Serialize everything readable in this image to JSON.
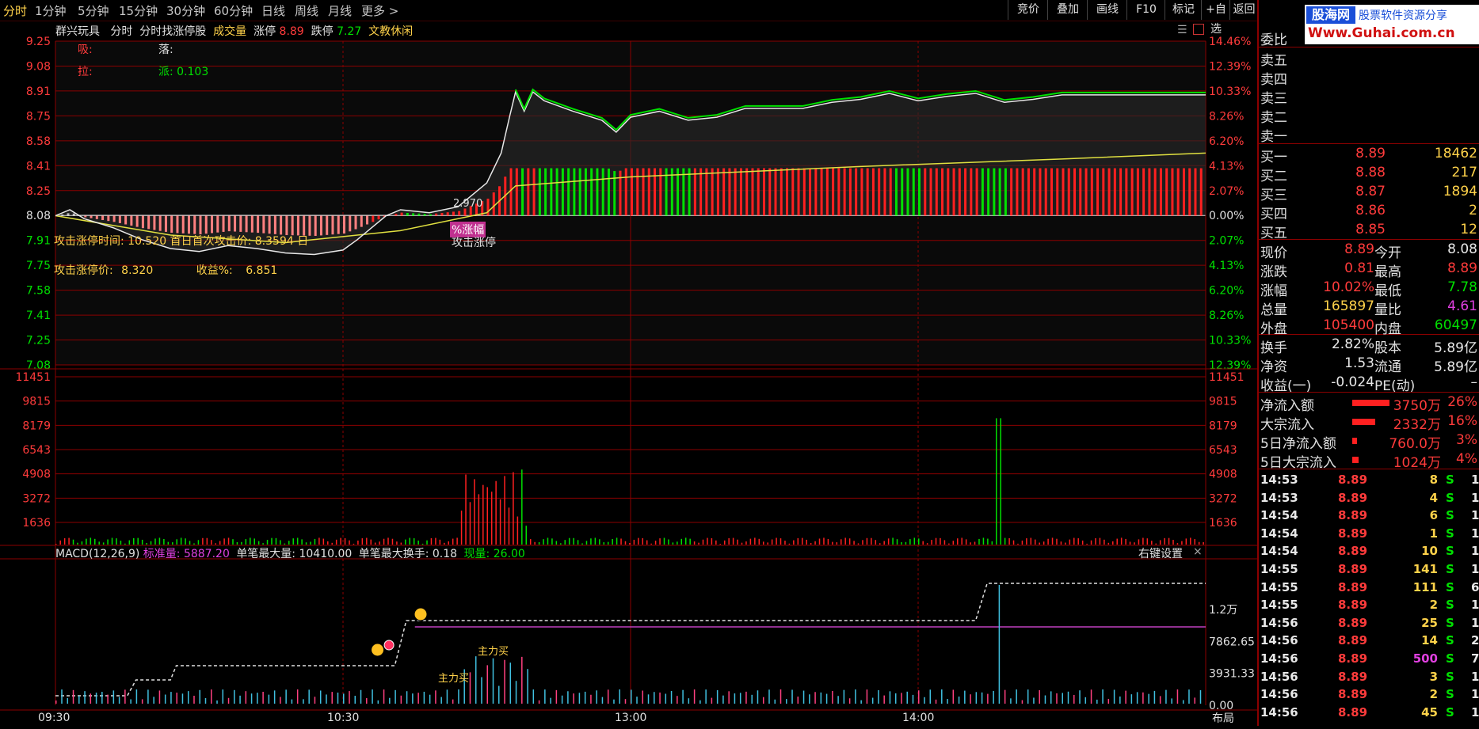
{
  "tabs": [
    {
      "label": "分时",
      "active": true
    },
    {
      "label": "1分钟"
    },
    {
      "label": "5分钟"
    },
    {
      "label": "15分钟"
    },
    {
      "label": "30分钟"
    },
    {
      "label": "60分钟"
    },
    {
      "label": "日线"
    },
    {
      "label": "周线"
    },
    {
      "label": "月线"
    },
    {
      "label": "更多 >"
    }
  ],
  "toolbar": [
    "竞价",
    "叠加",
    "画线",
    "F10",
    "标记",
    "+自选",
    "返回"
  ],
  "header": {
    "stock": "群兴玩具",
    "mode": "分时",
    "indicator": "分时找涨停股",
    "vol_label": "成交量",
    "up_label": "涨停",
    "up_val": "8.89",
    "down_label": "跌停",
    "down_val": "7.27",
    "sector": "文教休闲"
  },
  "indicator_labels": {
    "xi": "吸:",
    "luo": "落:",
    "la": "拉:",
    "pai": "派: 0.103"
  },
  "attack": {
    "line1": "攻击涨停时间: 10.520 首日首次攻击价: 8.3594 日",
    "price_label": "攻击涨停价:",
    "price_val": "8.320",
    "profit_label": "收益%:",
    "profit_val": "6.851",
    "marker_val": "2.970",
    "pct_label": "%涨幅",
    "attack_label": "攻击涨停"
  },
  "price_axis_left": [
    "9.25",
    "9.08",
    "8.91",
    "8.75",
    "8.58",
    "8.41",
    "8.25",
    "8.08",
    "7.91",
    "7.75",
    "7.58",
    "7.41",
    "7.25",
    "7.08"
  ],
  "price_axis_right": [
    "14.46%",
    "12.39%",
    "10.33%",
    "8.26%",
    "6.20%",
    "4.13%",
    "2.07%",
    "0.00%",
    "2.07%",
    "4.13%",
    "6.20%",
    "8.26%",
    "10.33%",
    "12.39%"
  ],
  "vol_axis": [
    "11451",
    "9815",
    "8179",
    "6543",
    "4908",
    "3272",
    "1636"
  ],
  "macd": {
    "label": "MACD(12,26,9)",
    "std_label": "标准量:",
    "std_val": "5887.20",
    "max_vol": "单笔最大量: 10410.00",
    "max_turn": "单笔最大换手: 0.18",
    "cur_label": "现量:",
    "cur_val": "26.00",
    "settings": "右键设置",
    "close": "×",
    "axis": [
      "1.2万",
      "7862.65",
      "3931.33",
      "0.00"
    ],
    "buy_label": "主力买"
  },
  "time_axis": [
    "09:30",
    "10:30",
    "13:00",
    "14:00"
  ],
  "layout_btn": "布局",
  "logo": {
    "name": "股海网",
    "slogan": "股票软件资源分享",
    "url": "Www.Guhai.com.cn"
  },
  "orderbook": {
    "weibi": "委比",
    "sell": [
      "卖五",
      "卖四",
      "卖三",
      "卖二",
      "卖一"
    ],
    "buy": [
      {
        "label": "买一",
        "price": "8.89",
        "vol": "18462"
      },
      {
        "label": "买二",
        "price": "8.88",
        "vol": "217"
      },
      {
        "label": "买三",
        "price": "8.87",
        "vol": "1894"
      },
      {
        "label": "买四",
        "price": "8.86",
        "vol": "2"
      },
      {
        "label": "买五",
        "price": "8.85",
        "vol": "12"
      }
    ]
  },
  "quote": [
    {
      "l1": "现价",
      "v1": "8.89",
      "c1": "red",
      "l2": "今开",
      "v2": "8.08",
      "c2": "wht"
    },
    {
      "l1": "涨跌",
      "v1": "0.81",
      "c1": "red",
      "l2": "最高",
      "v2": "8.89",
      "c2": "red"
    },
    {
      "l1": "涨幅",
      "v1": "10.02%",
      "c1": "red",
      "l2": "最低",
      "v2": "7.78",
      "c2": "grn"
    },
    {
      "l1": "总量",
      "v1": "165897",
      "c1": "yel",
      "l2": "量比",
      "v2": "4.61",
      "c2": "mag"
    },
    {
      "l1": "外盘",
      "v1": "105400",
      "c1": "red",
      "l2": "内盘",
      "v2": "60497",
      "c2": "grn"
    }
  ],
  "fund": [
    {
      "l1": "换手",
      "v1": "2.82%",
      "l2": "股本",
      "v2": "5.89亿"
    },
    {
      "l1": "净资",
      "v1": "1.53",
      "l2": "流通",
      "v2": "5.89亿"
    },
    {
      "l1": "收益(一)",
      "v1": "-0.024",
      "l2": "PE(动)",
      "v2": "–"
    }
  ],
  "flow": [
    {
      "label": "净流入额",
      "val": "3750万",
      "pct": "26%",
      "bar": 0.9
    },
    {
      "label": "大宗流入",
      "val": "2332万",
      "pct": "16%",
      "bar": 0.55
    },
    {
      "label": "5日净流入额",
      "val": "760.0万",
      "pct": "3%",
      "bar": 0.12
    },
    {
      "label": "5日大宗流入",
      "val": "1024万",
      "pct": "4%",
      "bar": 0.15
    }
  ],
  "ticks": [
    {
      "t": "14:53",
      "p": "8.89",
      "v": "8",
      "s": "S",
      "n": "1"
    },
    {
      "t": "14:53",
      "p": "8.89",
      "v": "4",
      "s": "S",
      "n": "1"
    },
    {
      "t": "14:54",
      "p": "8.89",
      "v": "6",
      "s": "S",
      "n": "1"
    },
    {
      "t": "14:54",
      "p": "8.89",
      "v": "1",
      "s": "S",
      "n": "1"
    },
    {
      "t": "14:54",
      "p": "8.89",
      "v": "10",
      "s": "S",
      "n": "1"
    },
    {
      "t": "14:55",
      "p": "8.89",
      "v": "141",
      "s": "S",
      "n": "1"
    },
    {
      "t": "14:55",
      "p": "8.89",
      "v": "111",
      "s": "S",
      "n": "6"
    },
    {
      "t": "14:55",
      "p": "8.89",
      "v": "2",
      "s": "S",
      "n": "1"
    },
    {
      "t": "14:56",
      "p": "8.89",
      "v": "25",
      "s": "S",
      "n": "1"
    },
    {
      "t": "14:56",
      "p": "8.89",
      "v": "14",
      "s": "S",
      "n": "2"
    },
    {
      "t": "14:56",
      "p": "8.89",
      "v": "500",
      "s": "S",
      "n": "7"
    },
    {
      "t": "14:56",
      "p": "8.89",
      "v": "3",
      "s": "S",
      "n": "1"
    },
    {
      "t": "14:56",
      "p": "8.89",
      "v": "2",
      "s": "S",
      "n": "1"
    },
    {
      "t": "14:56",
      "p": "8.89",
      "v": "45",
      "s": "S",
      "n": "1"
    }
  ],
  "chart_data": {
    "type": "line",
    "base_price": 8.08,
    "ylim": [
      7.08,
      9.25
    ],
    "price_points": [
      [
        0,
        8.08
      ],
      [
        5,
        8.12
      ],
      [
        10,
        8.06
      ],
      [
        20,
        8.0
      ],
      [
        30,
        7.92
      ],
      [
        40,
        7.86
      ],
      [
        50,
        7.84
      ],
      [
        60,
        7.88
      ],
      [
        70,
        7.86
      ],
      [
        80,
        7.83
      ],
      [
        90,
        7.82
      ],
      [
        100,
        7.85
      ],
      [
        105,
        7.92
      ],
      [
        110,
        8.0
      ],
      [
        115,
        8.08
      ],
      [
        120,
        8.12
      ],
      [
        130,
        8.1
      ],
      [
        140,
        8.14
      ],
      [
        150,
        8.3
      ],
      [
        155,
        8.5
      ],
      [
        158,
        8.75
      ],
      [
        160,
        8.91
      ],
      [
        163,
        8.78
      ],
      [
        166,
        8.91
      ],
      [
        170,
        8.85
      ],
      [
        180,
        8.78
      ],
      [
        190,
        8.72
      ],
      [
        195,
        8.64
      ],
      [
        200,
        8.74
      ],
      [
        210,
        8.78
      ],
      [
        220,
        8.72
      ],
      [
        230,
        8.74
      ],
      [
        240,
        8.8
      ],
      [
        250,
        8.8
      ],
      [
        260,
        8.8
      ],
      [
        270,
        8.84
      ],
      [
        280,
        8.86
      ],
      [
        290,
        8.9
      ],
      [
        300,
        8.85
      ],
      [
        310,
        8.88
      ],
      [
        320,
        8.9
      ],
      [
        330,
        8.84
      ],
      [
        340,
        8.86
      ],
      [
        350,
        8.89
      ],
      [
        360,
        8.89
      ],
      [
        400,
        8.89
      ]
    ],
    "avg_points": [
      [
        0,
        8.08
      ],
      [
        40,
        7.95
      ],
      [
        80,
        7.9
      ],
      [
        120,
        7.98
      ],
      [
        150,
        8.1
      ],
      [
        160,
        8.28
      ],
      [
        200,
        8.34
      ],
      [
        280,
        8.41
      ],
      [
        350,
        8.46
      ],
      [
        400,
        8.5
      ]
    ],
    "vol_max": 12000
  }
}
